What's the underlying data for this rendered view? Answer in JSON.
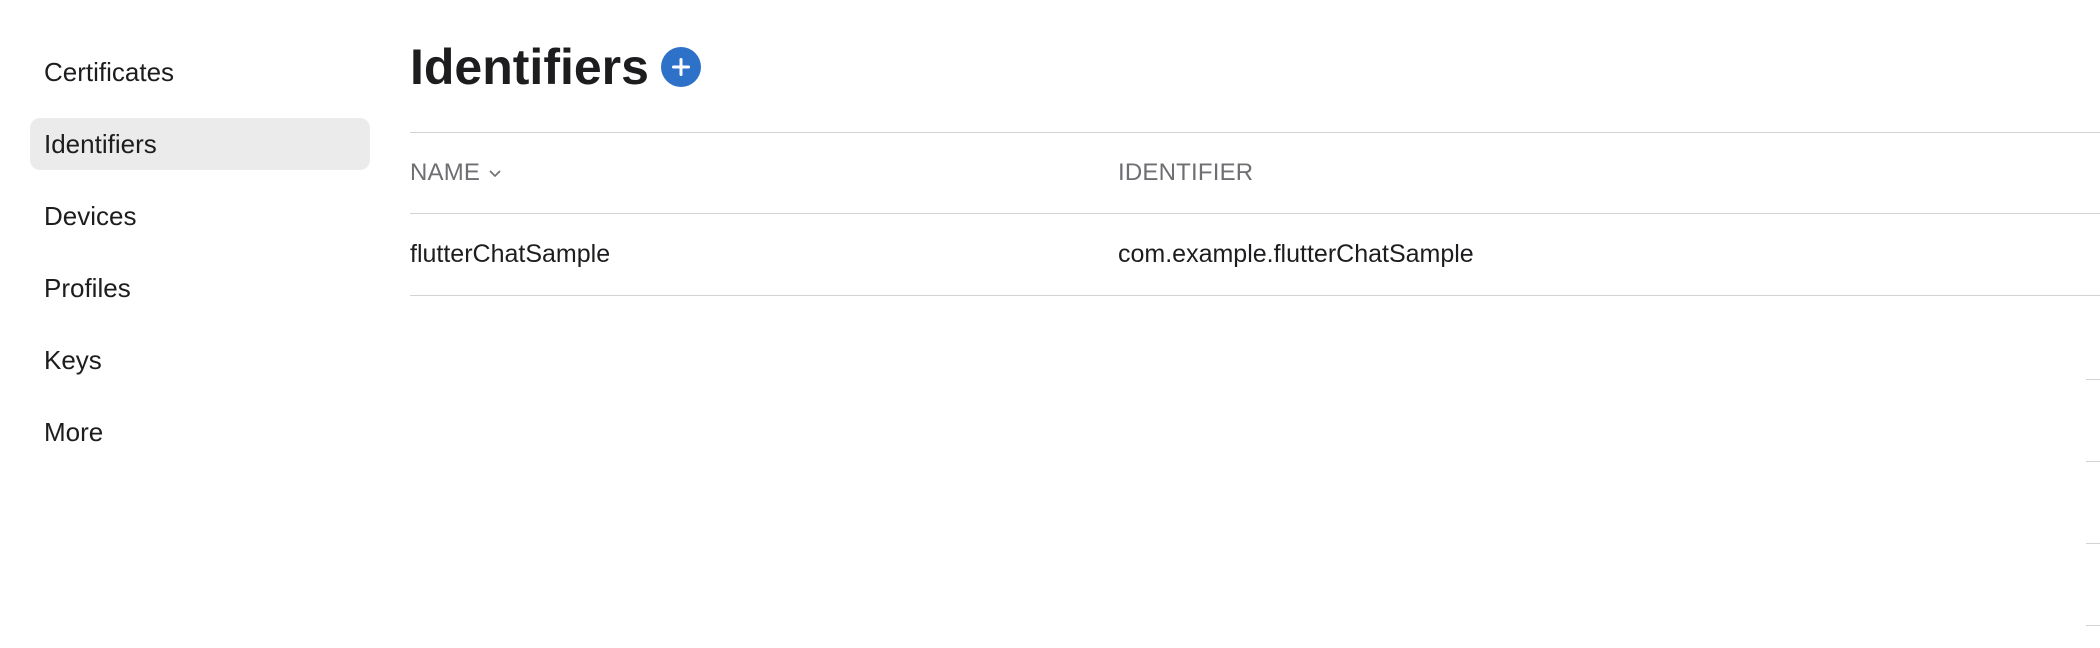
{
  "sidebar": {
    "items": [
      {
        "label": "Certificates"
      },
      {
        "label": "Identifiers"
      },
      {
        "label": "Devices"
      },
      {
        "label": "Profiles"
      },
      {
        "label": "Keys"
      },
      {
        "label": "More"
      }
    ],
    "active": "Identifiers"
  },
  "main": {
    "title": "Identifiers",
    "add_icon": "plus-circle-icon",
    "table": {
      "columns": [
        {
          "label": "NAME",
          "sortable": true
        },
        {
          "label": "IDENTIFIER"
        }
      ],
      "rows": [
        {
          "name": "flutterChatSample",
          "identifier": "com.example.flutterChatSample"
        }
      ]
    }
  },
  "colors": {
    "accent": "#2d72c8",
    "active_bg": "#ebebeb",
    "divider": "#d2d2d7",
    "muted_text": "#6e6e73"
  }
}
